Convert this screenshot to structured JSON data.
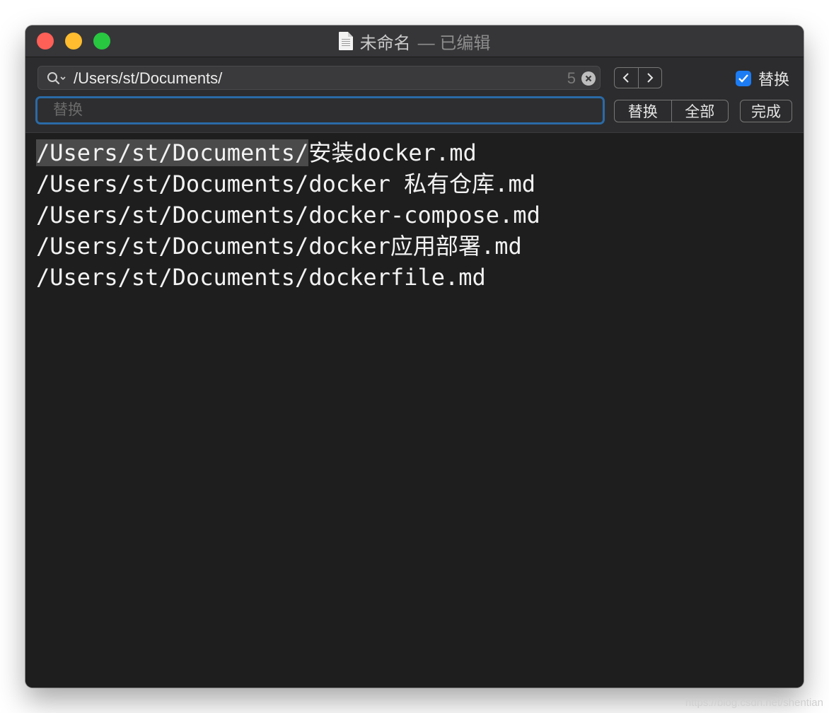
{
  "window": {
    "title": "未命名",
    "title_suffix": "— 已编辑",
    "traffic_lights": {
      "close": "#fe5f57",
      "minimize": "#febc2e",
      "zoom": "#28c840"
    }
  },
  "find": {
    "query": "/Users/st/Documents/",
    "match_count": "5",
    "replace_enabled": true,
    "replace_toggle_label": "替换",
    "replace_placeholder": "替换",
    "replace_value": "",
    "replace_button": "替换",
    "replace_all_button": "全部",
    "done_button": "完成",
    "accent_color": "#1c7cf4"
  },
  "editor": {
    "lines": [
      {
        "prefix": "/Users/st/Documents/",
        "cjk": "安装",
        "spelled": "docker.md",
        "rest": ""
      },
      {
        "prefix": "/Users/st/Documents/",
        "plain": "docker 私有仓库.",
        "spelled": "md"
      },
      {
        "prefix": "/Users/st/Documents/",
        "spelled": "docker-compose.md"
      },
      {
        "prefix": "/Users/st/Documents/",
        "plain": "docker应用部署.",
        "spelled": "md"
      },
      {
        "prefix": "/Users/st/Documents/",
        "spelled": "dockerfile.md"
      }
    ]
  },
  "watermark": "https://blog.csdn.net/shentian"
}
